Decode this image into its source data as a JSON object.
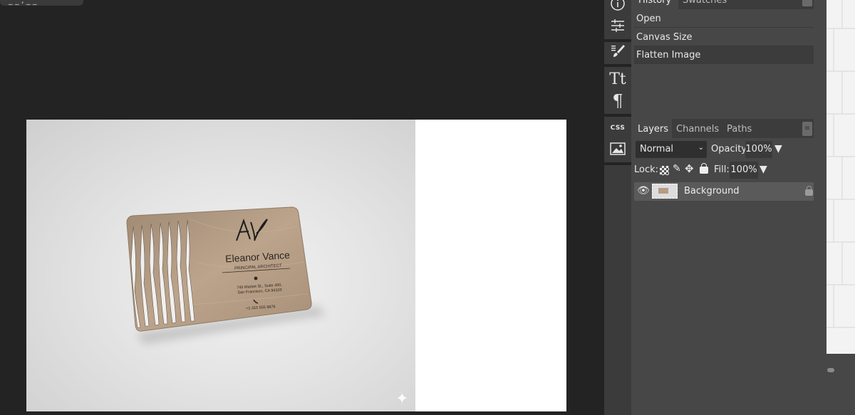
{
  "document_tab": {
    "label": "_ _ , _ _"
  },
  "history_panel": {
    "tabs": [
      {
        "label": "History"
      },
      {
        "label": "Swatches"
      }
    ],
    "items": [
      {
        "label": "Open"
      },
      {
        "label": "Canvas Size"
      },
      {
        "label": "Flatten Image"
      }
    ],
    "selected_index": 2
  },
  "layers_panel": {
    "tabs": [
      {
        "label": "Layers"
      },
      {
        "label": "Channels"
      },
      {
        "label": "Paths"
      }
    ],
    "blend_mode": "Normal",
    "opacity_label": "Opacity:",
    "opacity_value": "100%",
    "lock_label": "Lock:",
    "fill_label": "Fill:",
    "fill_value": "100%",
    "layers": [
      {
        "name": "Background",
        "visible": true,
        "locked": true
      }
    ]
  },
  "tools": {
    "css_label": "CSS"
  },
  "business_card": {
    "name": "Eleanor Vance",
    "title": "PRINCIPAL ARCHITECT",
    "address_line1": "745 Market St., Suite 400,",
    "address_line2": "San Francisco, CA 94103",
    "phone": "+1 415 555 9876",
    "logo": "AV"
  },
  "colors": {
    "accent_bg": "#232323",
    "panel_bg": "#474747",
    "wood": "#b59c84"
  }
}
